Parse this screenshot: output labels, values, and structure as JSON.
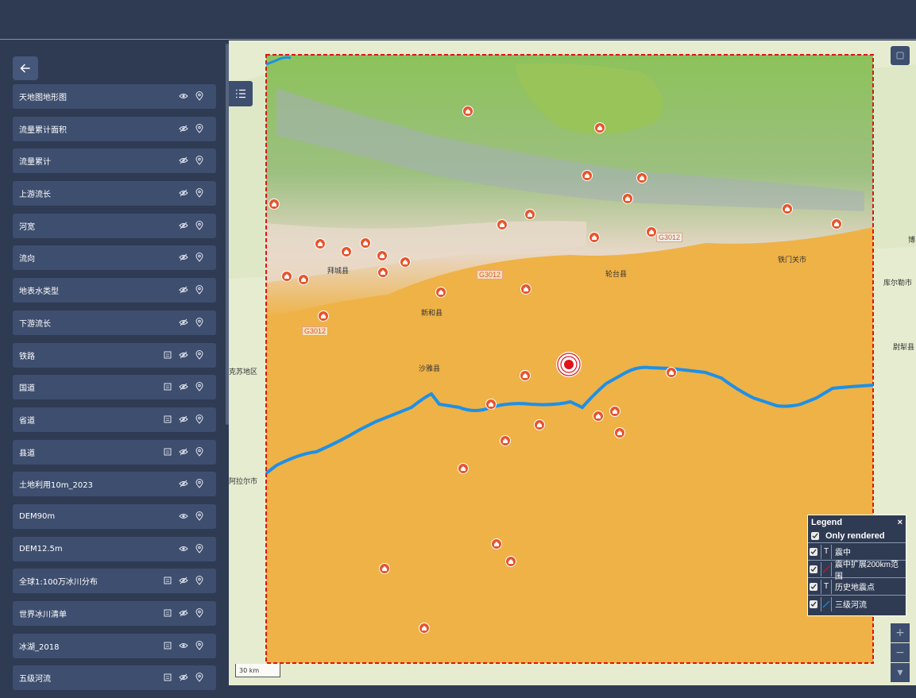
{
  "sidebar": {
    "layers": [
      {
        "label": "天地图地形图",
        "has_table": false,
        "visible": true
      },
      {
        "label": "流量累计面积",
        "has_table": false,
        "visible": false
      },
      {
        "label": "流量累计",
        "has_table": false,
        "visible": false
      },
      {
        "label": "上游流长",
        "has_table": false,
        "visible": false
      },
      {
        "label": "河宽",
        "has_table": false,
        "visible": false
      },
      {
        "label": "流向",
        "has_table": false,
        "visible": false
      },
      {
        "label": "地表水类型",
        "has_table": false,
        "visible": false
      },
      {
        "label": "下游流长",
        "has_table": false,
        "visible": false
      },
      {
        "label": "铁路",
        "has_table": true,
        "visible": false
      },
      {
        "label": "国道",
        "has_table": true,
        "visible": false
      },
      {
        "label": "省道",
        "has_table": true,
        "visible": false
      },
      {
        "label": "县道",
        "has_table": true,
        "visible": false
      },
      {
        "label": "土地利用10m_2023",
        "has_table": false,
        "visible": false
      },
      {
        "label": "DEM90m",
        "has_table": false,
        "visible": true
      },
      {
        "label": "DEM12.5m",
        "has_table": false,
        "visible": true
      },
      {
        "label": "全球1:100万冰川分布",
        "has_table": true,
        "visible": false
      },
      {
        "label": "世界冰川清单",
        "has_table": true,
        "visible": false
      },
      {
        "label": "冰湖_2018",
        "has_table": true,
        "visible": true
      },
      {
        "label": "五级河流",
        "has_table": true,
        "visible": false
      }
    ]
  },
  "map": {
    "places": [
      {
        "label": "拜城县",
        "id": "baicheng"
      },
      {
        "label": "新和县",
        "id": "xinhe"
      },
      {
        "label": "沙雅县",
        "id": "shaya"
      },
      {
        "label": "轮台县",
        "id": "luntai"
      },
      {
        "label": "铁门关市",
        "id": "tiemenguan"
      },
      {
        "label": "库尔勒市",
        "id": "kuerle"
      },
      {
        "label": "尉犁县",
        "id": "yuli"
      },
      {
        "label": "阿拉尔市",
        "id": "alaer"
      },
      {
        "label": "克苏地区",
        "id": "akesu"
      },
      {
        "label": "博",
        "id": "bo"
      }
    ],
    "road_shields": [
      "G3012",
      "G3012",
      "G3012"
    ],
    "scale_label": "30 km"
  },
  "legend": {
    "title": "Legend",
    "close": "×",
    "only_rendered": "Only rendered",
    "items": [
      {
        "label": "震中",
        "symbol": "T"
      },
      {
        "label": "震中扩展200km范围",
        "symbol": "line-red"
      },
      {
        "label": "历史地震点",
        "symbol": "T"
      },
      {
        "label": "三级河流",
        "symbol": "line-blue"
      }
    ]
  },
  "zoom": {
    "in": "+",
    "out": "−",
    "down": "▾"
  },
  "colors": {
    "accent": "#3e4e6f",
    "background": "#2f3b53",
    "river": "#1e90e6",
    "desert": "#efb246",
    "boundary": "#e0121a",
    "marker": "#e8552c"
  }
}
